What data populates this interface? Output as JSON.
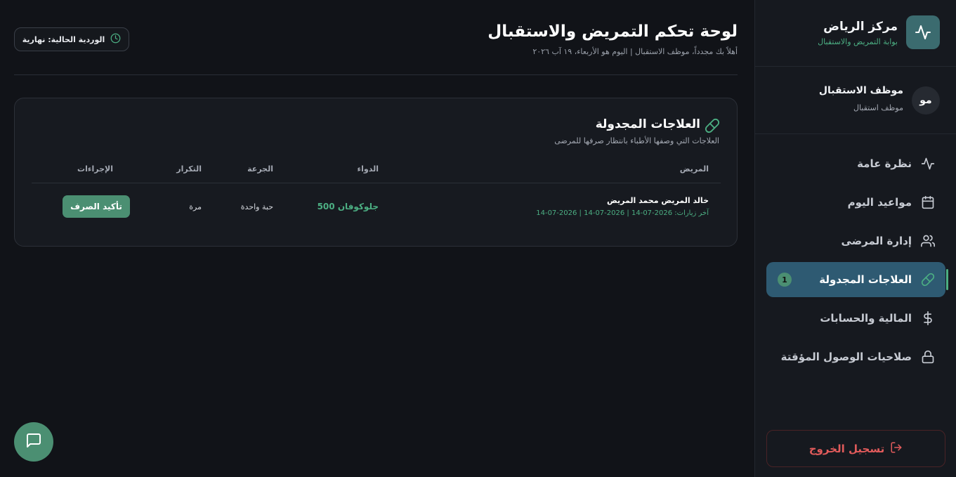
{
  "brand": {
    "title": "مركز الرياض",
    "subtitle": "بوابة التمريض والاستقبال",
    "logo_icon": "activity-icon"
  },
  "user": {
    "initials": "مو",
    "name": "موظف الاستقبال",
    "role": "موظف استقبال"
  },
  "nav": {
    "items": [
      {
        "label": "نظرة عامة",
        "icon": "activity-icon",
        "active": false
      },
      {
        "label": "مواعيد اليوم",
        "icon": "calendar-icon",
        "active": false
      },
      {
        "label": "إدارة المرضى",
        "icon": "users-icon",
        "active": false
      },
      {
        "label": "العلاجات المجدولة",
        "icon": "pill-icon",
        "active": true,
        "badge": "1"
      },
      {
        "label": "المالية والحسابات",
        "icon": "dollar-icon",
        "active": false
      },
      {
        "label": "صلاحيات الوصول المؤقتة",
        "icon": "lock-icon",
        "active": false
      }
    ]
  },
  "logout_label": "تسجيل الخروج",
  "header": {
    "title": "لوحة تحكم التمريض والاستقبال",
    "subtitle": "أهلاً بك مجدداً، موظف الاستقبال | اليوم هو الأربعاء، ١٩ آب ٢٠٢٦",
    "shift_label": "الوردية الحالية: نهارية"
  },
  "card": {
    "title": "العلاجات المجدولة",
    "subtitle": "العلاجات التي وصفها الأطباء بانتظار صرفها للمرضى",
    "columns": {
      "patient": "المريض",
      "drug": "الدواء",
      "dose": "الجرعة",
      "frequency": "التكرار",
      "actions": "الإجراءات"
    },
    "rows": [
      {
        "patient": "خالد المريض محمد المريض",
        "visits": "آخر زيارات: 2026-07-14 | 2026-07-14 | 2026-07-14",
        "drug": "جلوكوفان 500",
        "dose": "حبة واحدة",
        "frequency": "مرة",
        "action": "تأكيد الصرف"
      }
    ]
  },
  "colors": {
    "accent": "#4caf83",
    "active_nav": "#2e5a72",
    "danger": "#e25b5b",
    "background": "#111318"
  }
}
